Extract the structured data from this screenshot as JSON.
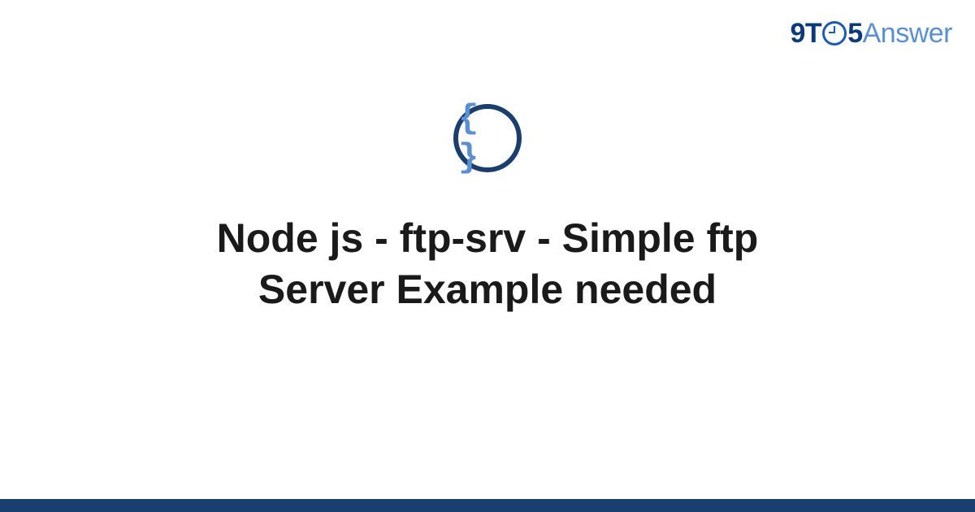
{
  "brand": {
    "part1": "9T",
    "part2": "5",
    "part3": "Answer"
  },
  "icon": {
    "braces": "{ }"
  },
  "main": {
    "title": "Node js - ftp-srv - Simple ftp Server Example needed"
  },
  "colors": {
    "accent_dark": "#1a3f6e",
    "accent_light": "#5a8fd4",
    "logo_dark": "#0a3a7a"
  }
}
